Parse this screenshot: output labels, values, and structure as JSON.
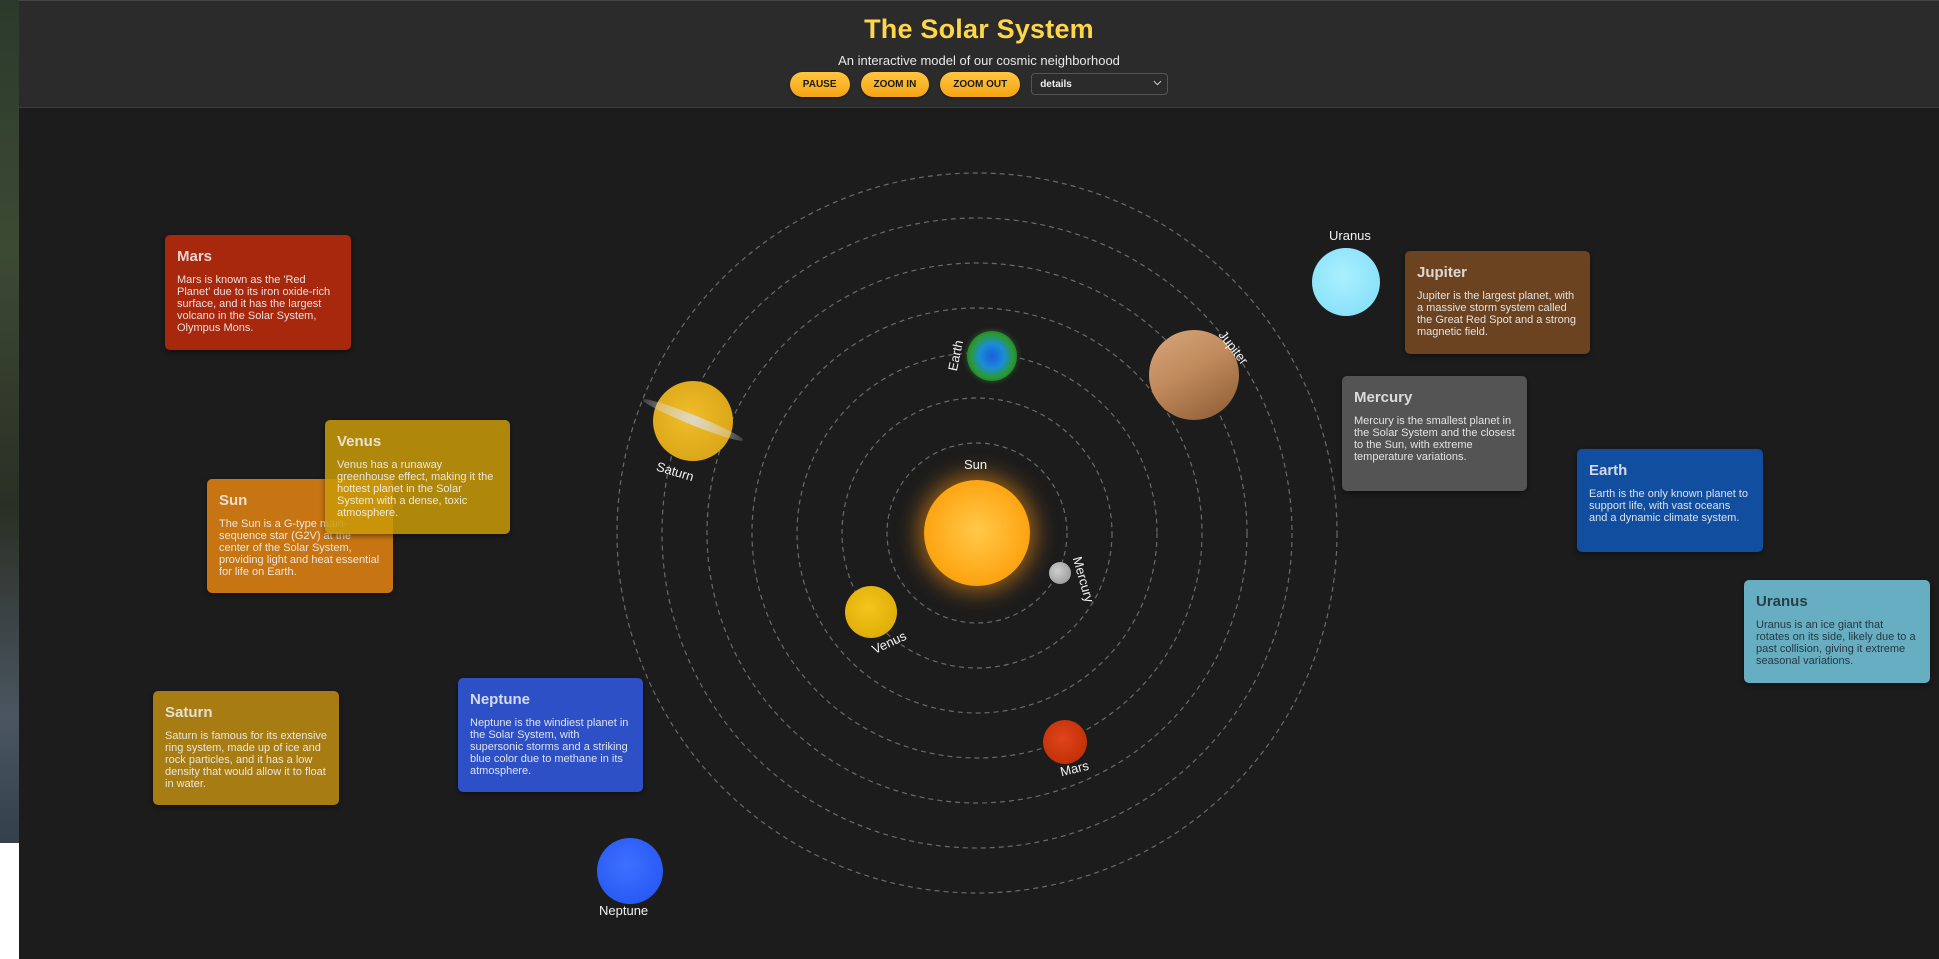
{
  "header": {
    "title": "The Solar System",
    "subtitle": "An interactive model of our cosmic neighborhood"
  },
  "controls": {
    "pause_label": "PAUSE",
    "zoom_in_label": "ZOOM IN",
    "zoom_out_label": "ZOOM OUT",
    "view_select": {
      "selected": "details"
    }
  },
  "bodies": {
    "sun": {
      "label": "Sun",
      "color": "#ffa516"
    },
    "mercury": {
      "label": "Mercury",
      "color": "#9e9e9e"
    },
    "venus": {
      "label": "Venus",
      "color": "#e6b800"
    },
    "earth": {
      "label": "Earth",
      "color": "#1e90ff"
    },
    "mars": {
      "label": "Mars",
      "color": "#cc3300"
    },
    "jupiter": {
      "label": "Jupiter",
      "color": "#b07a4f"
    },
    "saturn": {
      "label": "Saturn",
      "color": "#e0a81e"
    },
    "uranus": {
      "label": "Uranus",
      "color": "#88e6ff"
    },
    "neptune": {
      "label": "Neptune",
      "color": "#2f62ff"
    }
  },
  "cards": {
    "mars": {
      "title": "Mars",
      "text": "Mars is known as the 'Red Planet' due to its iron oxide-rich surface, and it has the largest volcano in the Solar System, Olympus Mons.",
      "color": "#a8280e"
    },
    "venus": {
      "title": "Venus",
      "text": "Venus has a runaway greenhouse effect, making it the hottest planet in the Solar System with a dense, toxic atmosphere.",
      "color": "#c99a07"
    },
    "sun": {
      "title": "Sun",
      "text": "The Sun is a G-type main-sequence star (G2V) at the center of the Solar System, providing light and heat essential for life on Earth.",
      "color": "#c77512"
    },
    "saturn": {
      "title": "Saturn",
      "text": "Saturn is famous for its extensive ring system, made up of ice and rock particles, and it has a low density that would allow it to float in water.",
      "color": "#a67c13"
    },
    "neptune": {
      "title": "Neptune",
      "text": "Neptune is the windiest planet in the Solar System, with supersonic storms and a striking blue color due to methane in its atmosphere.",
      "color": "#2e50c7"
    },
    "jupiter": {
      "title": "Jupiter",
      "text": "Jupiter is the largest planet, with a massive storm system called the Great Red Spot and a strong magnetic field.",
      "color": "#6b4321"
    },
    "mercury": {
      "title": "Mercury",
      "text": "Mercury is the smallest planet in the Solar System and the closest to the Sun, with extreme temperature variations.",
      "color": "#545454"
    },
    "earth": {
      "title": "Earth",
      "text": "Earth is the only known planet to support life, with vast oceans and a dynamic climate system.",
      "color": "#114ea0"
    },
    "uranus": {
      "title": "Uranus",
      "text": "Uranus is an ice giant that rotates on its side, likely due to a past collision, giving it extreme seasonal variations.",
      "color": "#67aec2"
    }
  }
}
